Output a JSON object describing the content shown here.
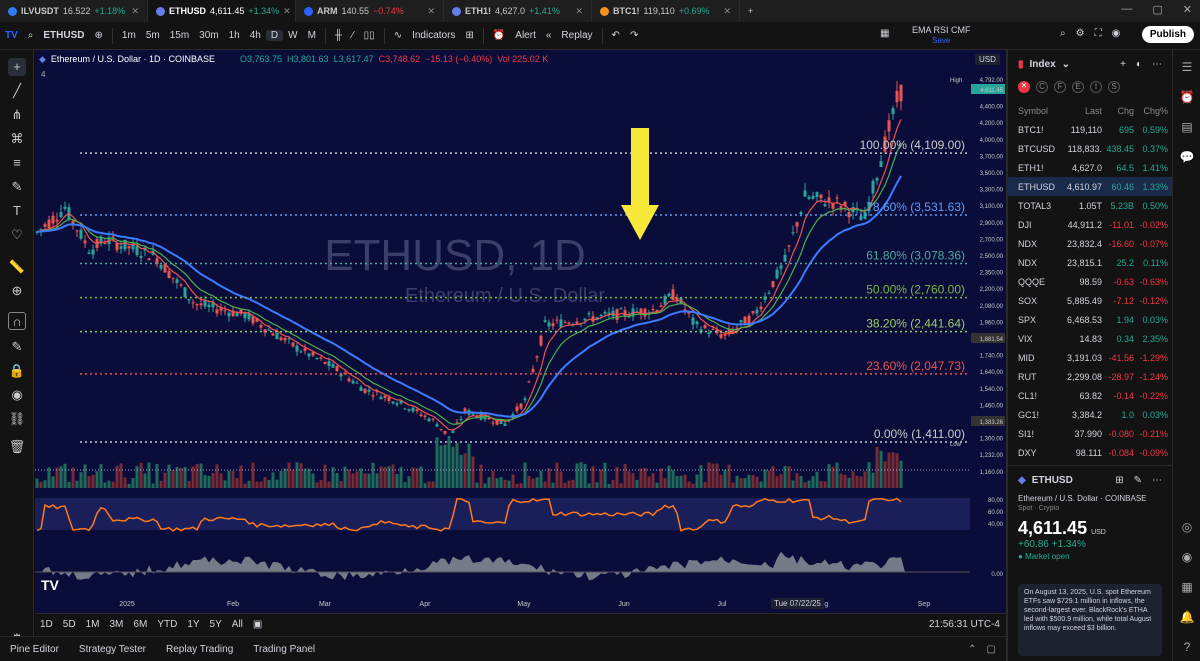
{
  "tabs": [
    {
      "symbol": "ILVUSDT",
      "price": "16.522",
      "change": "+1.18%",
      "dir": "up",
      "color": "#3179f5"
    },
    {
      "symbol": "ETHUSD",
      "price": "4,611.45",
      "change": "+1.34%",
      "dir": "up",
      "color": "#627eea"
    },
    {
      "symbol": "ARM",
      "price": "140.55",
      "change": "−0.74%",
      "dir": "dn",
      "color": "#2962ff"
    },
    {
      "symbol": "ETH1!",
      "price": "4,627.0",
      "change": "+1.41%",
      "dir": "up",
      "color": "#627eea"
    },
    {
      "symbol": "BTC1!",
      "price": "119,110",
      "change": "+0.69%",
      "dir": "up",
      "color": "#f7931a"
    }
  ],
  "toolbar": {
    "symbol": "ETHUSD",
    "intervals": [
      "1m",
      "5m",
      "15m",
      "30m",
      "1h",
      "4h",
      "D",
      "W",
      "M"
    ],
    "active_interval": "D",
    "indicators": "Indicators",
    "alert": "Alert",
    "replay": "Replay",
    "layout_name": "EMA RSI CMF",
    "layout_sub": "Save",
    "publish": "Publish"
  },
  "chart": {
    "title": "Ethereum / U.S. Dollar · 1D · COINBASE",
    "ohlc": {
      "o": "O3,763.75",
      "h": "H3,801.63",
      "l": "L3,617.47",
      "c": "C3,748.62",
      "chg": "−15.13 (−0.40%)"
    },
    "vol": "Vol 225.02 K",
    "indicator_count": "4",
    "currency": "USD",
    "watermark": "ETHUSD, 1D",
    "watermark_sub": "Ethereum / U.S. Dollar",
    "fib": [
      {
        "level": "100.00% (4,109.00)",
        "color": "#c9c9c9"
      },
      {
        "level": "78.60% (3,531.63)",
        "color": "#5b9cf6"
      },
      {
        "level": "61.80% (3,078.36)",
        "color": "#4fa8a0"
      },
      {
        "level": "50.00% (2,760.00)",
        "color": "#7cb342"
      },
      {
        "level": "38.20% (2,441.64)",
        "color": "#9ccc65"
      },
      {
        "level": "23.60% (2,047.73)",
        "color": "#ef5350"
      },
      {
        "level": "0.00% (1,411.00)",
        "color": "#c9c9c9"
      }
    ],
    "price_axis": [
      "4,611.45",
      "4,400.00",
      "4,200.00",
      "4,000.00",
      "3,700.00",
      "3,500.00",
      "3,300.00",
      "3,100.00",
      "2,900.00",
      "2,700.00",
      "2,500.00",
      "2,350.00",
      "2,200.00",
      "2,080.00",
      "1,960.00",
      "1,881.54",
      "1,740.00",
      "1,640.00",
      "1,540.00",
      "1,460.00",
      "1,383.26",
      "1,300.00",
      "1,232.00",
      "1,160.00"
    ],
    "high_label": "High",
    "high_val": "4,792.00",
    "low_label": "Low",
    "low_val": "1,383.26",
    "rsi_axis": [
      "80.00",
      "60.00",
      "40.00"
    ],
    "cmf_axis": [
      "0.00"
    ],
    "time_axis": [
      "2025",
      "Feb",
      "Mar",
      "Apr",
      "May",
      "Jun",
      "Jul",
      "Aug",
      "Sep"
    ],
    "cursor_date": "Tue 07/22/25"
  },
  "bottom": {
    "ranges": [
      "1D",
      "5D",
      "1M",
      "3M",
      "6M",
      "YTD",
      "1Y",
      "5Y",
      "All"
    ],
    "clock": "21:56:31 UTC-4"
  },
  "panels": [
    "Pine Editor",
    "Strategy Tester",
    "Replay Trading",
    "Trading Panel"
  ],
  "watchlist": {
    "title": "Index",
    "cols": [
      "Symbol",
      "Last",
      "Chg",
      "Chg%"
    ],
    "rows": [
      {
        "s": "BTC1!",
        "l": "119,110",
        "c": "695",
        "p": "0.59%",
        "d": "up"
      },
      {
        "s": "BTCUSD",
        "l": "118,833.",
        "c": "438.45",
        "p": "0.37%",
        "d": "up"
      },
      {
        "s": "ETH1!",
        "l": "4,627.0",
        "c": "64.5",
        "p": "1.41%",
        "d": "up"
      },
      {
        "s": "ETHUSD",
        "l": "4,610.97",
        "c": "60.46",
        "p": "1.33%",
        "d": "up",
        "sel": true
      },
      {
        "s": "TOTAL3",
        "l": "1.05T",
        "c": "5.23B",
        "p": "0.50%",
        "d": "up"
      },
      {
        "s": "DJI",
        "l": "44,911.2",
        "c": "-11.01",
        "p": "-0.02%",
        "d": "dn"
      },
      {
        "s": "NDX",
        "l": "23,832.4",
        "c": "-16.60",
        "p": "-0.07%",
        "d": "dn"
      },
      {
        "s": "NDX",
        "l": "23,815.1",
        "c": "25.2",
        "p": "0.11%",
        "d": "up"
      },
      {
        "s": "QQQE",
        "l": "98.59",
        "c": "-0.63",
        "p": "-0.63%",
        "d": "dn"
      },
      {
        "s": "SOX",
        "l": "5,885.49",
        "c": "-7.12",
        "p": "-0.12%",
        "d": "dn"
      },
      {
        "s": "SPX",
        "l": "6,468.53",
        "c": "1.94",
        "p": "0.03%",
        "d": "up"
      },
      {
        "s": "VIX",
        "l": "14.83",
        "c": "0.34",
        "p": "2.35%",
        "d": "up"
      },
      {
        "s": "MID",
        "l": "3,191.03",
        "c": "-41.56",
        "p": "-1.29%",
        "d": "dn"
      },
      {
        "s": "RUT",
        "l": "2,299.08",
        "c": "-28.97",
        "p": "-1.24%",
        "d": "dn"
      },
      {
        "s": "CL1!",
        "l": "63.82",
        "c": "-0.14",
        "p": "-0.22%",
        "d": "dn"
      },
      {
        "s": "GC1!",
        "l": "3,384.2",
        "c": "1.0",
        "p": "0.03%",
        "d": "up"
      },
      {
        "s": "SI1!",
        "l": "37.990",
        "c": "-0.080",
        "p": "-0.21%",
        "d": "dn"
      },
      {
        "s": "DXY",
        "l": "98.111",
        "c": "-0.084",
        "p": "-0.09%",
        "d": "dn"
      }
    ]
  },
  "detail": {
    "symbol": "ETHUSD",
    "name": "Ethereum / U.S. Dollar",
    "exchange": "COINBASE",
    "type": "Spot · Crypto",
    "price": "4,611.45",
    "currency": "USD",
    "change": "+60.86 +1.34%",
    "status": "Market open",
    "news": "On August 13, 2025, U.S. spot Ethereum ETFs saw $729.1 million in inflows, the second-largest ever. BlackRock's ETHA led with $500.9 million, while total August inflows may exceed $3 billion."
  }
}
